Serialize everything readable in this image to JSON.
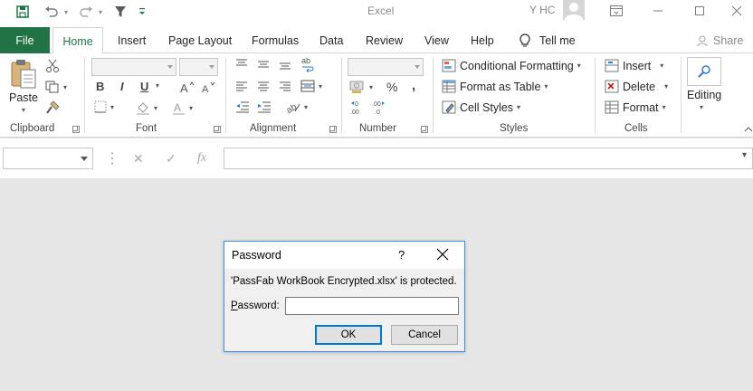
{
  "window": {
    "app_title": "Excel",
    "user_name": "Y HC"
  },
  "tabs": {
    "file": "File",
    "items": [
      "Home",
      "Insert",
      "Page Layout",
      "Formulas",
      "Data",
      "Review",
      "View",
      "Help"
    ],
    "tell_me": "Tell me",
    "share": "Share"
  },
  "ribbon": {
    "clipboard": {
      "label": "Clipboard",
      "paste": "Paste"
    },
    "font": {
      "label": "Font",
      "bold": "B",
      "italic": "I",
      "underline": "U"
    },
    "alignment": {
      "label": "Alignment"
    },
    "number": {
      "label": "Number",
      "percent": "%",
      "comma": ","
    },
    "styles": {
      "label": "Styles",
      "conditional_formatting": "Conditional Formatting",
      "format_as_table": "Format as Table",
      "cell_styles": "Cell Styles"
    },
    "cells": {
      "label": "Cells",
      "insert": "Insert",
      "delete": "Delete",
      "format": "Format"
    },
    "editing": {
      "label": "Editing"
    }
  },
  "formula_bar": {
    "fx": "fx",
    "cancel": "✕",
    "enter": "✓",
    "name_box_value": "",
    "formula_value": ""
  },
  "dialog": {
    "title": "Password",
    "help": "?",
    "message": "'PassFab WorkBook Encrypted.xlsx' is protected.",
    "password_label_first": "P",
    "password_label_rest": "assword:",
    "password_value": "",
    "ok": "OK",
    "cancel": "Cancel"
  },
  "colors": {
    "accent": "#217346",
    "dialog_border": "#3a8ee6",
    "primary_button_border": "#0078d7"
  }
}
